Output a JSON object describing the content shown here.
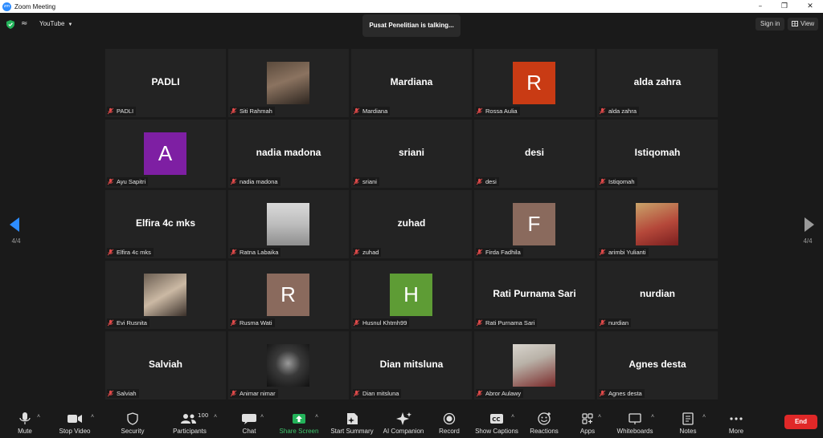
{
  "window": {
    "title": "Zoom Meeting",
    "app_icon_text": "zm"
  },
  "topbar": {
    "source_label": "YouTube",
    "talking": "Pusat Penelitian is talking...",
    "signin": "Sign in",
    "view": "View"
  },
  "paging": {
    "left": "4/4",
    "right": "4/4"
  },
  "participants": [
    {
      "name": "PADLI",
      "display": "text"
    },
    {
      "name": "Siti Rahmah",
      "display": "photo"
    },
    {
      "name": "Mardiana",
      "display": "text"
    },
    {
      "name": "Rossa Aulia",
      "display": "avatar",
      "letter": "R",
      "color": "#c93b14"
    },
    {
      "name": "alda zahra",
      "display": "text"
    },
    {
      "name": "Ayu Sapitri",
      "display": "avatar",
      "letter": "A",
      "color": "#7e1fa3"
    },
    {
      "name": "nadia madona",
      "display": "text"
    },
    {
      "name": "sriani",
      "display": "text"
    },
    {
      "name": "desi",
      "display": "text"
    },
    {
      "name": "Istiqomah",
      "display": "text"
    },
    {
      "name": "Elfira 4c mks",
      "display": "text"
    },
    {
      "name": "Ratna Labaika",
      "display": "photo"
    },
    {
      "name": "zuhad",
      "display": "text"
    },
    {
      "name": "Firda Fadhila",
      "display": "avatar",
      "letter": "F",
      "color": "#8a6a5d"
    },
    {
      "name": "arimbi Yulianti",
      "display": "photo"
    },
    {
      "name": "Evi Rusnita",
      "display": "photo"
    },
    {
      "name": "Rusma Wati",
      "display": "avatar",
      "letter": "R",
      "color": "#8a6a5d"
    },
    {
      "name": "Husnul Khtmh99",
      "display": "avatar",
      "letter": "H",
      "color": "#5e9c35"
    },
    {
      "name": "Rati Purnama Sari",
      "display": "text"
    },
    {
      "name": "nurdian",
      "display": "text"
    },
    {
      "name": "Salviah",
      "display": "text"
    },
    {
      "name": "Animar nimar",
      "display": "photo"
    },
    {
      "name": "Dian mitsluna",
      "display": "text"
    },
    {
      "name": "Abror Aulawy",
      "display": "photo"
    },
    {
      "name": "Agnes desta",
      "display": "text"
    }
  ],
  "toolbar": {
    "mute": "Mute",
    "stop_video": "Stop Video",
    "security": "Security",
    "participants": "Participants",
    "participants_count": "100",
    "chat": "Chat",
    "share_screen": "Share Screen",
    "start_summary": "Start Summary",
    "ai_companion": "AI Companion",
    "record": "Record",
    "show_captions": "Show Captions",
    "reactions": "Reactions",
    "apps": "Apps",
    "whiteboards": "Whiteboards",
    "notes": "Notes",
    "more": "More",
    "end": "End"
  },
  "colors": {
    "accent": "#2d8cff",
    "share": "#3ec46b",
    "end": "#e02828",
    "muted_icon": "#e04a4a"
  }
}
